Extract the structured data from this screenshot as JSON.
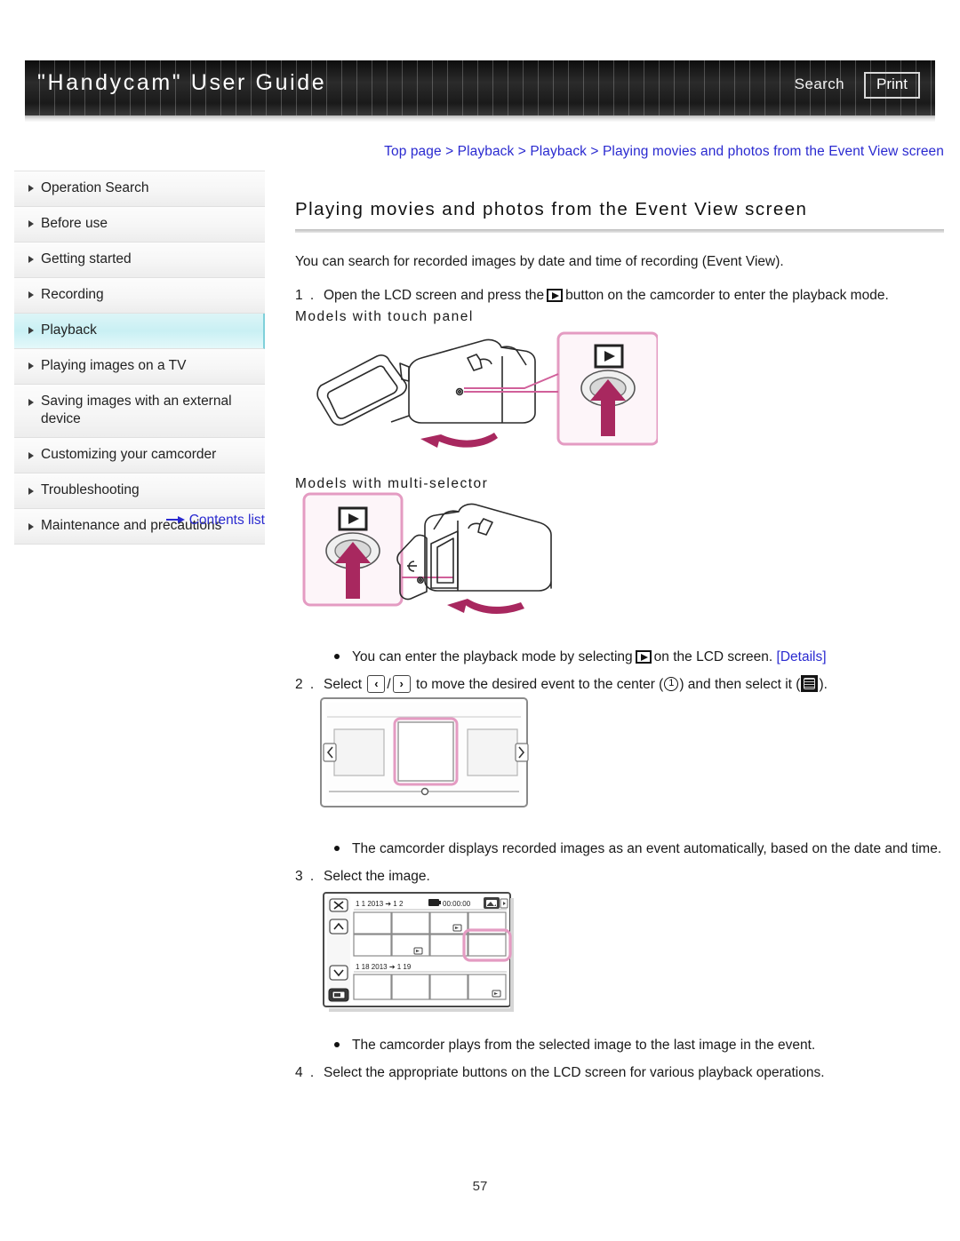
{
  "header": {
    "title": "\"Handycam\" User Guide",
    "search_label": "Search",
    "print_label": "Print"
  },
  "breadcrumb": {
    "text": "Top page > Playback > Playback > Playing movies and photos from the Event View screen"
  },
  "sidebar": {
    "items": [
      {
        "label": "Operation Search",
        "active": false
      },
      {
        "label": "Before use",
        "active": false
      },
      {
        "label": "Getting started",
        "active": false
      },
      {
        "label": "Recording",
        "active": false
      },
      {
        "label": "Playback",
        "active": true
      },
      {
        "label": "Playing images on a TV",
        "active": false
      },
      {
        "label": "Saving images with an external device",
        "active": false
      },
      {
        "label": "Customizing your camcorder",
        "active": false
      },
      {
        "label": "Troubleshooting",
        "active": false
      },
      {
        "label": "Maintenance and precautions",
        "active": false
      }
    ],
    "contents_link": "Contents list"
  },
  "main": {
    "title": "Playing movies and photos from the Event View screen",
    "intro": "You can search for recorded images by date and time of recording (Event View).",
    "step1_num": "1 .",
    "step1_a": "Open the LCD screen and press the",
    "step1_b": "button on the camcorder to enter the playback mode.",
    "subhead_touch": "Models with touch panel",
    "subhead_multi": "Models with multi-selector",
    "note1_a": "You can enter the playback mode by selecting",
    "note1_b": "on the LCD screen.",
    "note1_link": "[Details]",
    "step2_num": "2 .",
    "step2_a": "Select",
    "step2_sep": "/",
    "step2_b": "to move the desired event to the center (",
    "step2_c": ") and then select it (",
    "step2_d": ").",
    "left_arrow_glyph": "‹",
    "right_arrow_glyph": "›",
    "center_marker": "1",
    "note2": "The camcorder displays recorded images as an event automatically, based on the date and time.",
    "step3_num": "3 .",
    "step3": "Select the image.",
    "note3": "The camcorder plays from the selected image to the last image in the event.",
    "step4_num": "4 .",
    "step4": "Select the appropriate buttons on the LCD screen for various playback operations."
  },
  "lcd_screen": {
    "date_range_1": "1 1 2013 ➔ 1 2",
    "date_range_2": "1 18 2013 ➔ 1 19",
    "timecode": "00:00:00",
    "close_glyph": "✕",
    "up_glyph": "∧",
    "down_glyph": "∨"
  },
  "colors": {
    "accent_pink": "#c9589a",
    "link_blue": "#2a2ad0",
    "highlight_cyan": "#c9f0f4",
    "header_dark": "#1a1a1a"
  },
  "footer": {
    "page_number": "57"
  }
}
